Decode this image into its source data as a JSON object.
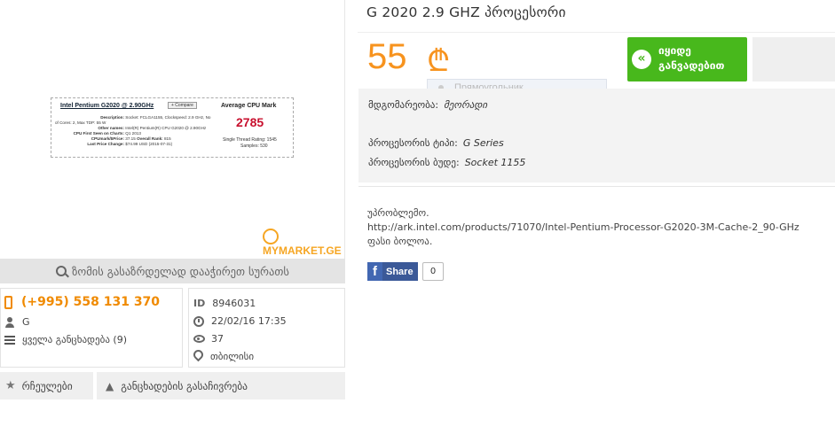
{
  "product": {
    "title": "G 2020 2.9 GHZ პროცესორი",
    "price": "55",
    "currency_symbol": "₾",
    "buy_label_line1": "იყიდე",
    "buy_label_line2": "განვადებით",
    "tooltip_text": "Прямоугольник"
  },
  "image": {
    "watermark": "MYMARKET.GE",
    "zoom_label": "ზომის გასაზრდელად დააჭირეთ სურათს",
    "cpu_card": {
      "name": "Intel Pentium G2020 @ 2.90GHz",
      "compare": "+ Compare",
      "avg_label": "Average CPU Mark",
      "score": "2785",
      "single_thread": "Single Thread Rating: 1545",
      "samples": "Samples: 530",
      "description_label": "Description:",
      "description": "Socket: FCLGA1155, Clockspeed: 2.9 GHz, No of Cores: 2, Max TDP: 55 W",
      "other_label": "Other names:",
      "other": "Intel(R) Pentium(R) CPU G2020 @ 2.90GHz",
      "first_seen_label": "CPU First Seen on Charts:",
      "first_seen": "Q1 2013",
      "mark_price_label": "CPUmark/$Price:",
      "mark_price": "37.15",
      "rank_label": "Overall Rank:",
      "rank": "815",
      "last_price_label": "Last Price Change:",
      "last_price": "$74.99 USD (2015-07-31)"
    }
  },
  "seller": {
    "phone": "(+995) 558 131 370",
    "name": "G",
    "all_ads": "ყველა განცხადება (9)"
  },
  "info": {
    "id_label": "ID",
    "id": "8946031",
    "date": "22/02/16 17:35",
    "views": "37",
    "location": "თბილისი"
  },
  "actions": {
    "favorites": "რჩეულები",
    "report": "განცხადების გასაჩივრება"
  },
  "specs": {
    "condition_label": "მდგომარეობა:",
    "condition": "მეორადი",
    "type_label": "პროცესორის ტიპი:",
    "type": "G Series",
    "socket_label": "პროცესორის ბუდე:",
    "socket": "Socket 1155"
  },
  "description": {
    "line1": "უპრობლემო.",
    "line2": "http://ark.intel.com/products/71070/Intel-Pentium-Processor-G2020-3M-Cache-2_90-GHz",
    "line3": "ფასი ბოლოა."
  },
  "share": {
    "label": "Share",
    "count": "0"
  }
}
